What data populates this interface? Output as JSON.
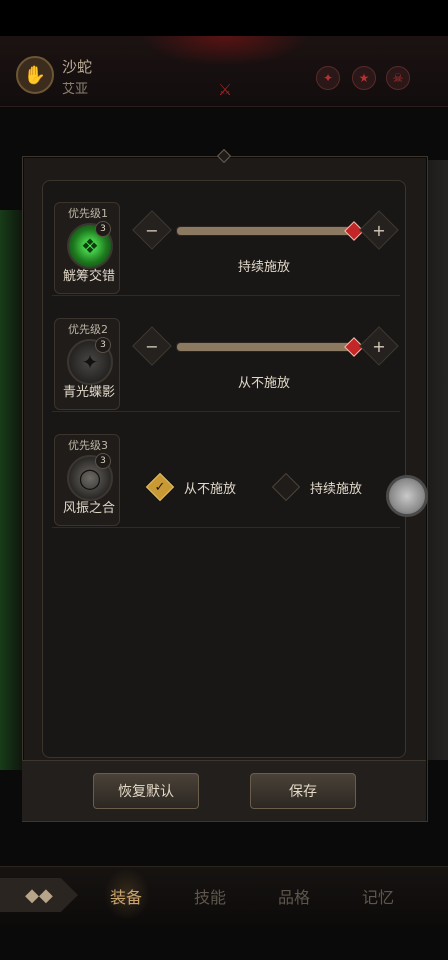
{
  "header": {
    "char_name": "沙蛇",
    "char_sub": "艾亚",
    "emblem_icon": "hand-emblem-icon"
  },
  "skills": [
    {
      "priority": "优先级1",
      "level": "3",
      "name": "觥筹交错",
      "icon": "green-crystal-skill-icon",
      "mode": "持续施放",
      "slider_value": 1.0,
      "minus": "−",
      "plus": "+"
    },
    {
      "priority": "优先级2",
      "level": "3",
      "name": "青光蝶影",
      "icon": "dark-blade-skill-icon",
      "mode": "从不施放",
      "slider_value": 1.0,
      "minus": "−",
      "plus": "+"
    },
    {
      "priority": "优先级3",
      "level": "3",
      "name": "风振之合",
      "icon": "ring-skill-icon",
      "options": [
        {
          "label": "从不施放",
          "checked": true
        },
        {
          "label": "持续施放",
          "checked": false
        }
      ]
    }
  ],
  "buttons": {
    "reset": "恢复默认",
    "save": "保存"
  },
  "nav": {
    "tabs": [
      "装备",
      "技能",
      "品格",
      "记忆"
    ],
    "active": "装备"
  },
  "colors": {
    "accent": "#c89934",
    "slider_thumb": "#c22626",
    "panel": "#1d1a18"
  }
}
